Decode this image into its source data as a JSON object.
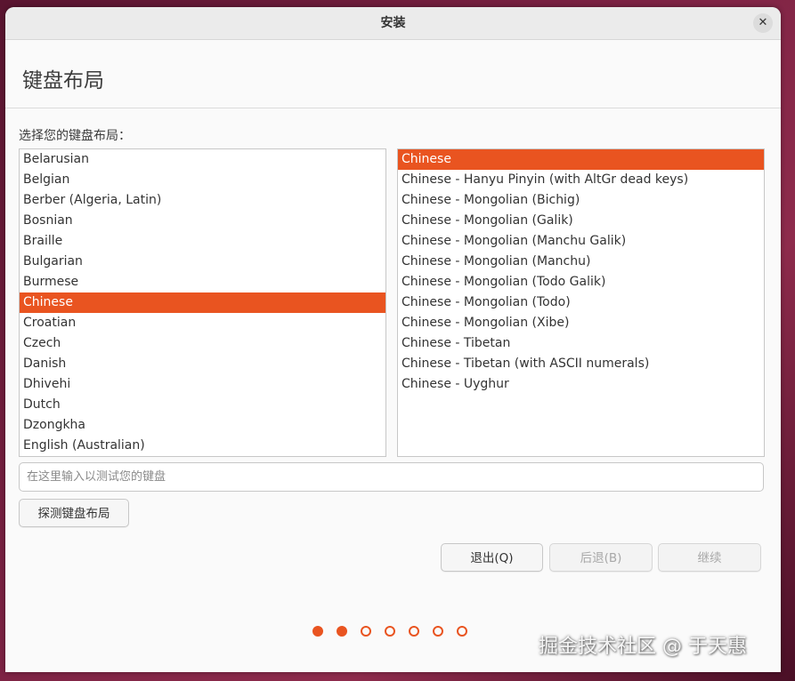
{
  "window": {
    "title": "安装",
    "close_glyph": "✕"
  },
  "page": {
    "title": "键盘布局",
    "prompt": "选择您的键盘布局："
  },
  "layouts": {
    "items": [
      {
        "label": "Belarusian",
        "selected": false
      },
      {
        "label": "Belgian",
        "selected": false
      },
      {
        "label": "Berber (Algeria, Latin)",
        "selected": false
      },
      {
        "label": "Bosnian",
        "selected": false
      },
      {
        "label": "Braille",
        "selected": false
      },
      {
        "label": "Bulgarian",
        "selected": false
      },
      {
        "label": "Burmese",
        "selected": false
      },
      {
        "label": "Chinese",
        "selected": true
      },
      {
        "label": "Croatian",
        "selected": false
      },
      {
        "label": "Czech",
        "selected": false
      },
      {
        "label": "Danish",
        "selected": false
      },
      {
        "label": "Dhivehi",
        "selected": false
      },
      {
        "label": "Dutch",
        "selected": false
      },
      {
        "label": "Dzongkha",
        "selected": false
      },
      {
        "label": "English (Australian)",
        "selected": false
      }
    ]
  },
  "variants": {
    "items": [
      {
        "label": "Chinese",
        "selected": true
      },
      {
        "label": "Chinese - Hanyu Pinyin (with AltGr dead keys)",
        "selected": false
      },
      {
        "label": "Chinese - Mongolian (Bichig)",
        "selected": false
      },
      {
        "label": "Chinese - Mongolian (Galik)",
        "selected": false
      },
      {
        "label": "Chinese - Mongolian (Manchu Galik)",
        "selected": false
      },
      {
        "label": "Chinese - Mongolian (Manchu)",
        "selected": false
      },
      {
        "label": "Chinese - Mongolian (Todo Galik)",
        "selected": false
      },
      {
        "label": "Chinese - Mongolian (Todo)",
        "selected": false
      },
      {
        "label": "Chinese - Mongolian (Xibe)",
        "selected": false
      },
      {
        "label": "Chinese - Tibetan",
        "selected": false
      },
      {
        "label": "Chinese - Tibetan (with ASCII numerals)",
        "selected": false
      },
      {
        "label": "Chinese - Uyghur",
        "selected": false
      }
    ]
  },
  "test_input": {
    "placeholder": "在这里输入以测试您的键盘",
    "value": ""
  },
  "buttons": {
    "detect": "探测键盘布局",
    "quit": "退出(Q)",
    "back": "后退(B)",
    "continue": "继续"
  },
  "progress": {
    "total_steps": 7,
    "completed_steps": 2
  },
  "watermark": "掘金技术社区 @ 于天惠",
  "colors": {
    "accent": "#e95420",
    "selection_text": "#ffffff"
  }
}
